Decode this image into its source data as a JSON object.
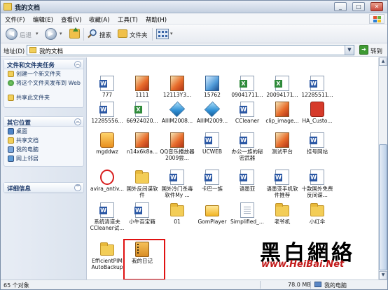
{
  "window": {
    "title": "我的文档"
  },
  "window_buttons": {
    "minimize": "_",
    "maximize": "□",
    "close": "✕"
  },
  "menu": [
    "文件(F)",
    "编辑(E)",
    "查看(V)",
    "收藏(A)",
    "工具(T)",
    "帮助(H)"
  ],
  "toolbar": {
    "back_label": "后退",
    "dropdown_glyph": "▾",
    "search_label": "搜索",
    "folders_label": "文件夹"
  },
  "address": {
    "label": "地址(D)",
    "value": "我的文档",
    "go_label": "转到"
  },
  "tasks": {
    "file_folder": {
      "header": "文件和文件夹任务",
      "items": [
        "创建一个新文件夹",
        "将这个文件夹发布到 Web",
        "共享此文件夹"
      ]
    },
    "other_places": {
      "header": "其它位置",
      "items": [
        "桌面",
        "共享文档",
        "我的电脑",
        "网上邻居"
      ]
    },
    "details": {
      "header": "详细信息"
    }
  },
  "files": [
    {
      "name": "777",
      "icon": "word"
    },
    {
      "name": "1111",
      "icon": "image"
    },
    {
      "name": "12113Y3...",
      "icon": "image"
    },
    {
      "name": "15762",
      "icon": "image-blue"
    },
    {
      "name": "09041711...",
      "icon": "excel"
    },
    {
      "name": "20094171...",
      "icon": "excel"
    },
    {
      "name": "12285511...",
      "icon": "word"
    },
    {
      "name": "12285556...",
      "icon": "word"
    },
    {
      "name": "66924020...",
      "icon": "excel"
    },
    {
      "name": "AllIM2008...",
      "icon": "cube"
    },
    {
      "name": "AllIM2009...",
      "icon": "cube"
    },
    {
      "name": "CCleaner",
      "icon": "word"
    },
    {
      "name": "clip_image...",
      "icon": "image"
    },
    {
      "name": "HA_Custo...",
      "icon": "red"
    },
    {
      "name": "mgddwz",
      "icon": "app-orange"
    },
    {
      "name": "n14x6k8a...",
      "icon": "image"
    },
    {
      "name": "QQ音乐播放器2009尝...",
      "icon": "image"
    },
    {
      "name": "UCWEB",
      "icon": "word"
    },
    {
      "name": "办公一族的秘密武器",
      "icon": "word"
    },
    {
      "name": "测试平台",
      "icon": "image"
    },
    {
      "name": "挂号网站",
      "icon": "word"
    },
    {
      "name": "avira_antiv...",
      "icon": "avira"
    },
    {
      "name": "国外反间谍软件",
      "icon": "folder"
    },
    {
      "name": "国外冷门杀毒软件My ...",
      "icon": "word"
    },
    {
      "name": "卡巴一族",
      "icon": "word"
    },
    {
      "name": "语墨亚",
      "icon": "word"
    },
    {
      "name": "语墨亚手机软件推荐",
      "icon": "word"
    },
    {
      "name": "十款国外免费反间谍...",
      "icon": "word"
    },
    {
      "name": "系统清道夫CCleaner试...",
      "icon": "word"
    },
    {
      "name": "小牛百宝箱",
      "icon": "word"
    },
    {
      "name": "01",
      "icon": "folder"
    },
    {
      "name": "GomPlayer",
      "icon": "gom"
    },
    {
      "name": "Simplified_...",
      "icon": "doc-plain"
    },
    {
      "name": "老爷机",
      "icon": "folder"
    },
    {
      "name": "小红伞",
      "icon": "folder"
    },
    {
      "name": "EfficientPIM AutoBackup",
      "icon": "folder"
    },
    {
      "name": "我的日记",
      "icon": "notebook"
    }
  ],
  "status": {
    "objects": "65 个对象",
    "size": "78.0 MB",
    "location": "我的电脑"
  },
  "watermark": {
    "chars": "黑白網絡",
    "url": "www.HeiBai.Net"
  },
  "colors": {
    "highlight": "#e01212",
    "link": "#1f3b66",
    "header": "#1d3a6a"
  }
}
